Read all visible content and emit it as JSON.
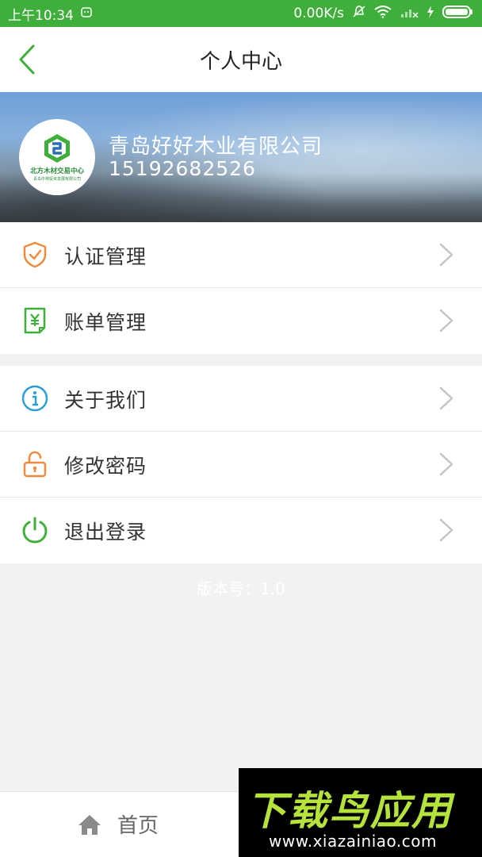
{
  "status_bar": {
    "time": "上午10:34",
    "network_speed": "0.00K/s"
  },
  "header": {
    "title": "个人中心",
    "back_icon": "chevron-left-icon"
  },
  "profile": {
    "company_name": "青岛好好木业有限公司",
    "phone": "15192682526",
    "avatar_logo_text": "北方木材交易中心",
    "avatar_logo_subtext": "青岛中林投资发展有限公司"
  },
  "menu": {
    "group1": [
      {
        "label": "认证管理",
        "icon": "shield-check-icon",
        "color": "#f08a3c"
      },
      {
        "label": "账单管理",
        "icon": "bill-yuan-icon",
        "color": "#3fae3a"
      }
    ],
    "group2": [
      {
        "label": "关于我们",
        "icon": "info-icon",
        "color": "#2a9fd6"
      },
      {
        "label": "修改密码",
        "icon": "lock-icon",
        "color": "#f08a3c"
      },
      {
        "label": "退出登录",
        "icon": "power-icon",
        "color": "#3fae3a"
      }
    ]
  },
  "version_text": "版本号：1.0",
  "bottom_nav": {
    "home_label": "首页",
    "home_icon": "home-icon"
  },
  "watermark": {
    "title": "下载鸟应用",
    "url": "www.xiazainiao.com"
  },
  "colors": {
    "accent": "#3fae3a",
    "background": "#f2f2f2"
  }
}
